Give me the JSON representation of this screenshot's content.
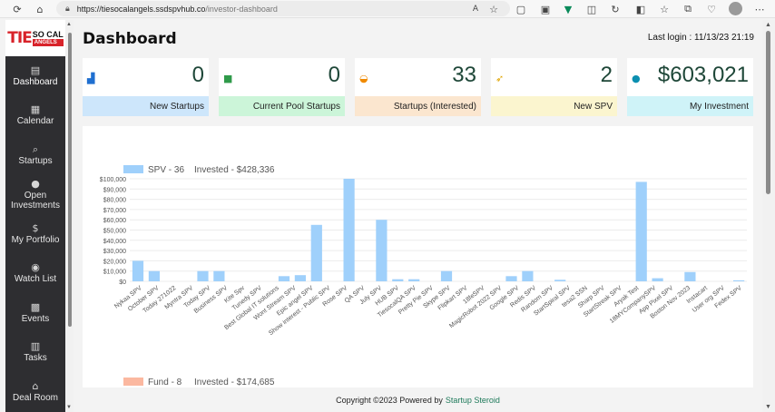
{
  "browser": {
    "url_host": "https://tiesocalangels.ssdspvhub.co",
    "url_path": "/investor-dashboard"
  },
  "logo": {
    "tie": "TIE",
    "socal": "SO CAL",
    "angels": "ANGELS"
  },
  "sidebar": {
    "items": [
      {
        "label": "Dashboard",
        "icon": "dashboard-icon",
        "active": true
      },
      {
        "label": "Calendar",
        "icon": "calendar-icon"
      },
      {
        "label": "Startups",
        "icon": "search-icon"
      },
      {
        "label": "Open Investments",
        "icon": "money-bag-icon"
      },
      {
        "label": "My Portfolio",
        "icon": "portfolio-icon"
      },
      {
        "label": "Watch List",
        "icon": "binoculars-icon"
      },
      {
        "label": "Events",
        "icon": "events-icon"
      },
      {
        "label": "Tasks",
        "icon": "tasks-icon"
      },
      {
        "label": "Deal Room",
        "icon": "deal-room-icon"
      }
    ]
  },
  "header": {
    "title": "Dashboard",
    "last_login": "Last login : 11/13/23 21:19"
  },
  "cards": [
    {
      "value": "0",
      "label": "New Startups",
      "label_bg": "#cde6fb",
      "icon": "chart-icon",
      "icon_color": "#1f6fd0"
    },
    {
      "value": "0",
      "label": "Current Pool Startups",
      "label_bg": "#ccf5d9",
      "icon": "briefcase-icon",
      "icon_color": "#2f9a4a"
    },
    {
      "value": "33",
      "label": "Startups (Interested)",
      "label_bg": "#fbe6cf",
      "icon": "hand-coin-icon",
      "icon_color": "#f08a00"
    },
    {
      "value": "2",
      "label": "New SPV",
      "label_bg": "#fbf5cf",
      "icon": "rocket-icon",
      "icon_color": "#e0a400"
    },
    {
      "value": "$603,021",
      "label": "My Investment",
      "label_bg": "#cff3f8",
      "icon": "money-bag-icon",
      "icon_color": "#0b8fb0"
    }
  ],
  "chart_data": {
    "type": "bar",
    "legend": {
      "label": "SPV - 36",
      "invested": "Invested - $428,336",
      "color": "#9fd0fb"
    },
    "categories": [
      "Nykaa SPV",
      "October SPV",
      "Today 271022",
      "Myntra SPV",
      "Today SPV",
      "Business SPV",
      "Kite Spv",
      "Tunedy SPV",
      "Best Global IT solutions",
      "Wont Stream SPV",
      "Epic angel SPV",
      "Show interest - Public SPV",
      "Rose SPV",
      "QA SPV",
      "July SPV",
      "HUB SPV",
      "TiesocalQA SPV",
      "Pretty Pie SPV",
      "Skype SPV",
      "Flipkart SPV",
      "18feSPV",
      "MagicRobot 2022 SPV",
      "Google SPV",
      "Redis SPV",
      "Random SPV",
      "StartSpiral SPV",
      "tesa2 SSN",
      "Sharp SPV",
      "StartStreak SPV",
      "Aryak Test",
      "18MYCompanySPV",
      "App Pixel SPV",
      "Boston Nov 2023",
      "Instacart",
      "User org SPV",
      "Fedex SPV"
    ],
    "values": [
      20000,
      10000,
      0,
      0,
      10000,
      10000,
      0,
      0,
      0,
      5000,
      6000,
      55000,
      0,
      100000,
      0,
      60000,
      2000,
      2000,
      0,
      10000,
      0,
      0,
      0,
      5000,
      10000,
      0,
      1500,
      0,
      0,
      0,
      0,
      97000,
      3000,
      0,
      9000,
      0,
      0,
      1000
    ],
    "y_ticks": [
      "$0",
      "$10,000",
      "$20,000",
      "$30,000",
      "$40,000",
      "$50,000",
      "$60,000",
      "$70,000",
      "$80,000",
      "$90,000",
      "$100,000"
    ],
    "ylim": [
      0,
      100000
    ],
    "second_legend": {
      "label": "Fund - 8",
      "invested": "Invested - $174,685",
      "color": "#fbb8a0"
    }
  },
  "footer": {
    "text": "Copyright ©2023 Powered by",
    "link": "Startup Steroid"
  }
}
